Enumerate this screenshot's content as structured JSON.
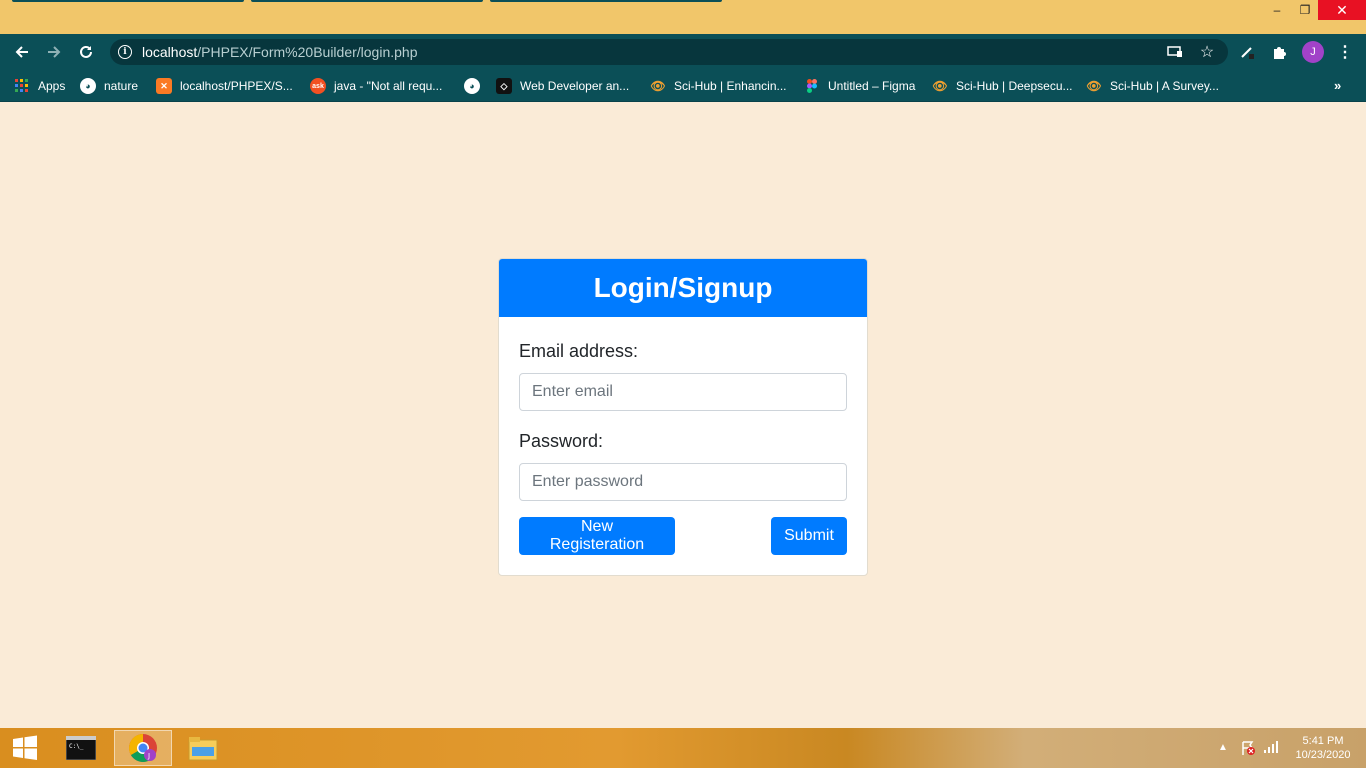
{
  "browser": {
    "url_host": "localhost",
    "url_path": "/PHPEX/Form%20Builder/login.php",
    "profile_initial": "J",
    "window_controls": {
      "minimize": "–",
      "restore": "❐",
      "close": "✕"
    }
  },
  "bookmarks": [
    {
      "label": "Apps",
      "icon": "apps-grid-icon"
    },
    {
      "label": "nature",
      "icon": "globe-icon"
    },
    {
      "label": "localhost/PHPEX/S...",
      "icon": "xampp-icon"
    },
    {
      "label": "java - \"Not all requ...",
      "icon": "ask-icon"
    },
    {
      "label": "",
      "icon": "globe-icon"
    },
    {
      "label": "Web Developer an...",
      "icon": "roadmap-icon"
    },
    {
      "label": "Sci-Hub | Enhancin...",
      "icon": "scihub-icon"
    },
    {
      "label": "Untitled – Figma",
      "icon": "figma-icon"
    },
    {
      "label": "Sci-Hub | Deepsecu...",
      "icon": "scihub-icon"
    },
    {
      "label": "Sci-Hub | A Survey...",
      "icon": "scihub-icon"
    }
  ],
  "form": {
    "title": "Login/Signup",
    "email_label": "Email address:",
    "email_placeholder": "Enter email",
    "password_label": "Password:",
    "password_placeholder": "Enter password",
    "register_label": "New Registeration",
    "submit_label": "Submit"
  },
  "taskbar": {
    "time": "5:41 PM",
    "date": "10/23/2020"
  },
  "colors": {
    "page_bg": "#faebd7",
    "browser_toolbar": "#0b4f57",
    "titlebar": "#f1c66a",
    "primary": "#007bff"
  }
}
